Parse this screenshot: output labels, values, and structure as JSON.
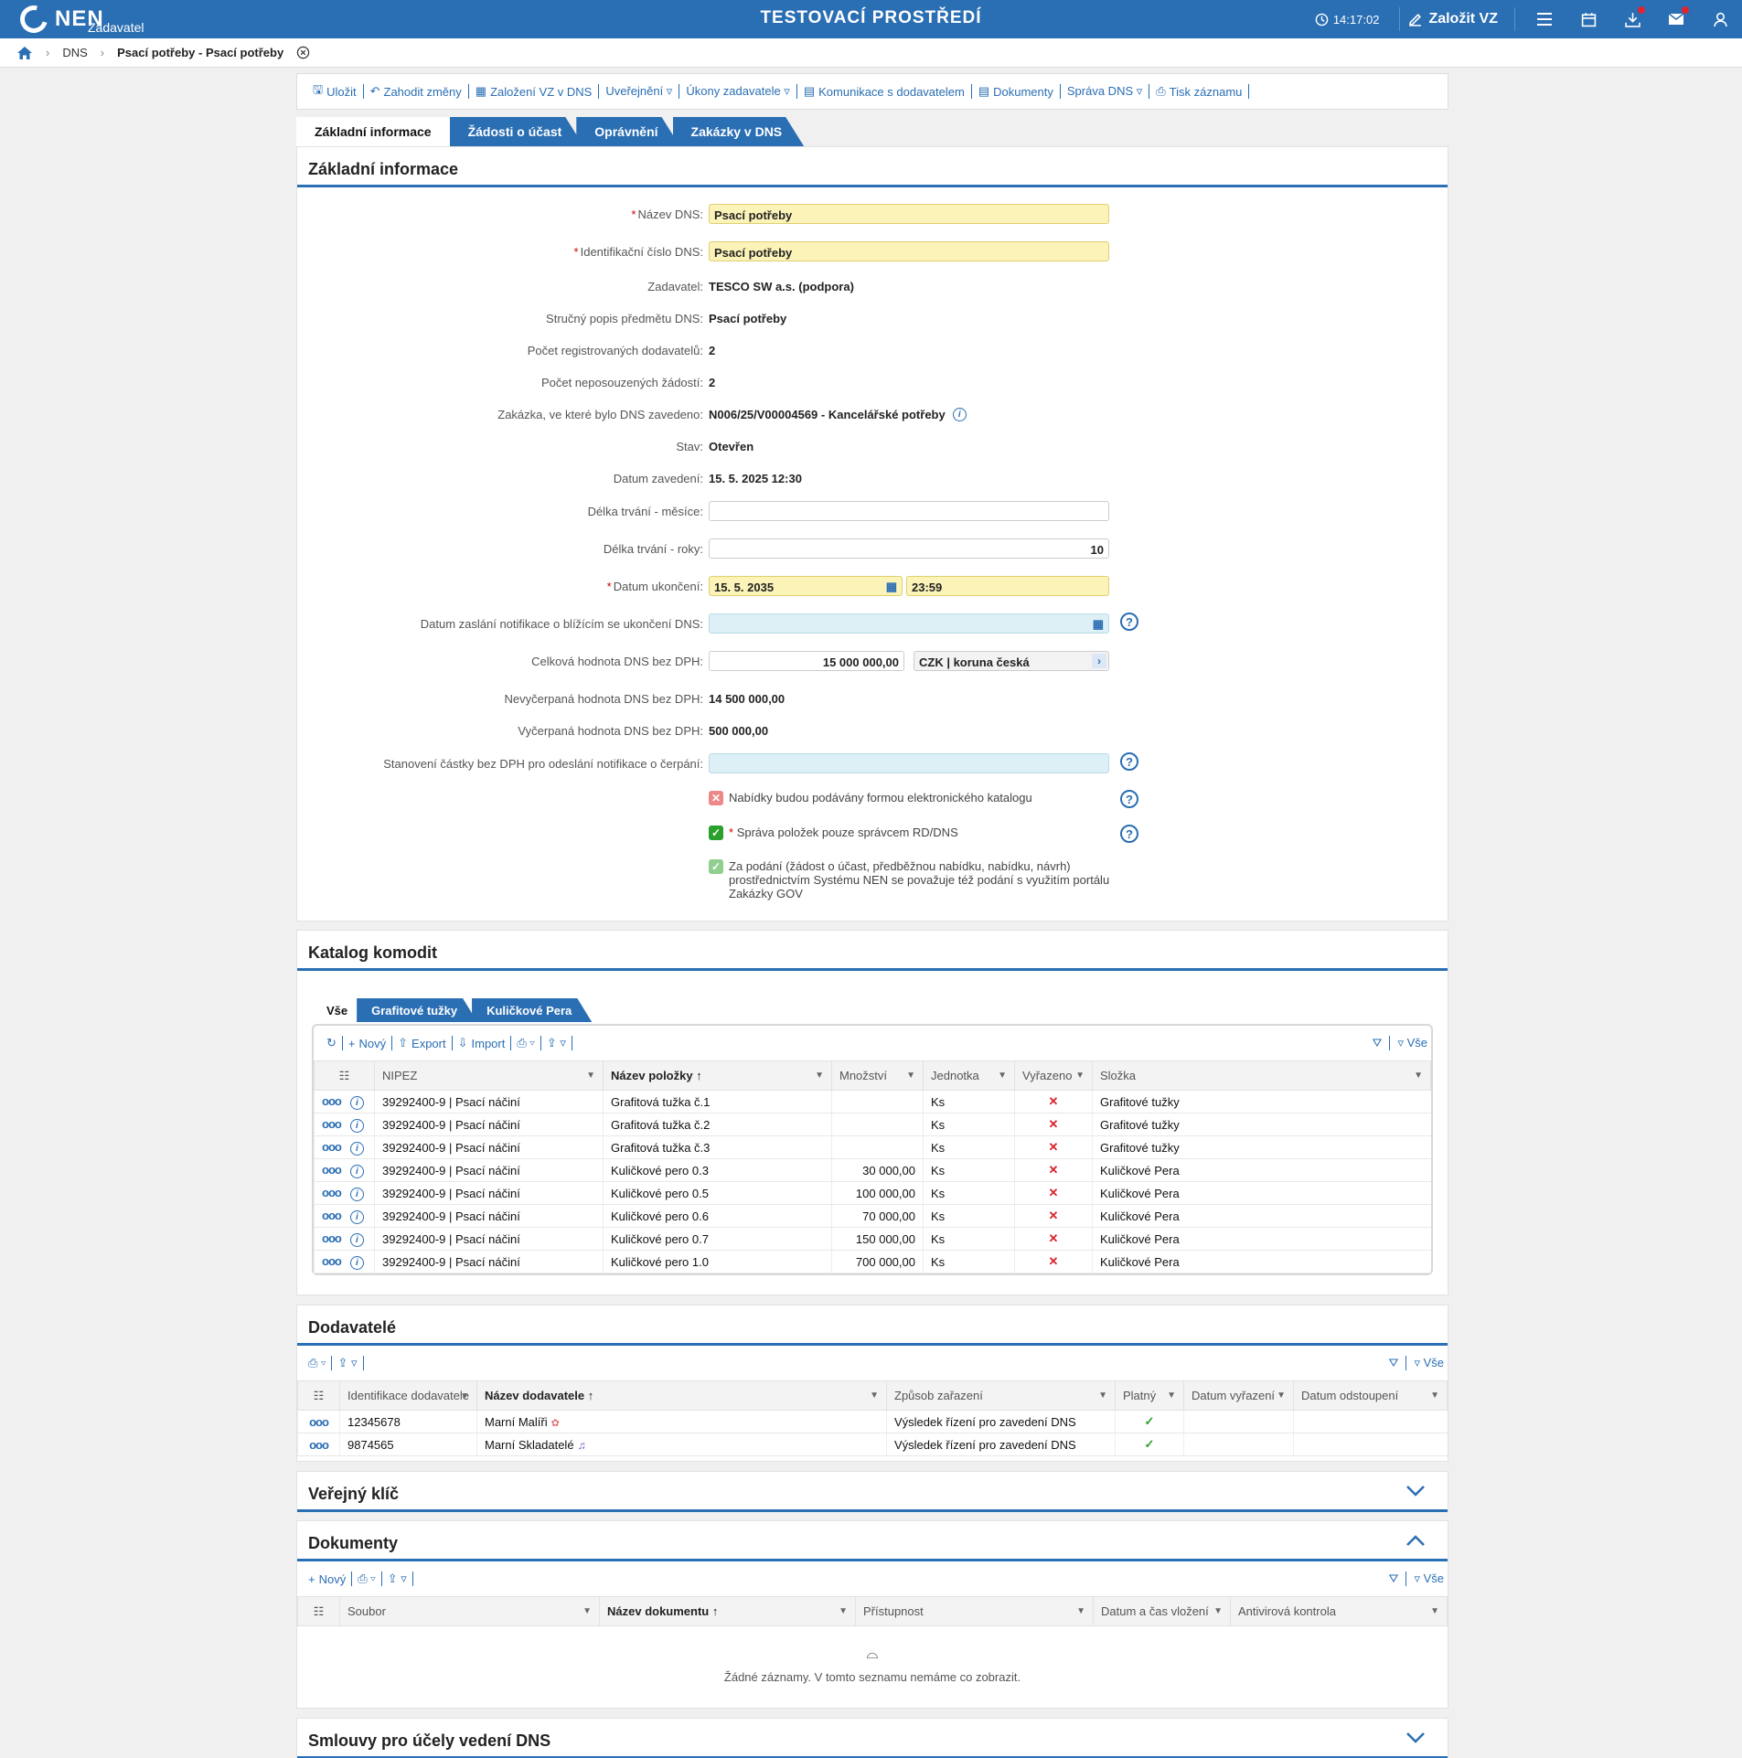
{
  "topbar": {
    "logo": "NEN",
    "role": "Zadavatel",
    "env": "TESTOVACÍ PROSTŘEDÍ",
    "time": "14:17:02",
    "create": "Založit VZ"
  },
  "breadcrumb": {
    "dns": "DNS",
    "current": "Psací potřeby - Psací potřeby"
  },
  "toolbar": [
    "Uložit",
    "Zahodit změny",
    "Založení VZ v DNS",
    "Uveřejnění ▿",
    "Úkony zadavatele ▿",
    "Komunikace s dodavatelem",
    "Dokumenty",
    "Správa DNS ▿",
    "Tisk záznamu"
  ],
  "tabs": [
    "Základní informace",
    "Žádosti o účast",
    "Oprávnění",
    "Zakázky v DNS"
  ],
  "basic": {
    "title": "Základní informace",
    "nazev_label": "Název DNS:",
    "nazev": "Psací potřeby",
    "id_label": "Identifikační číslo DNS:",
    "id": "Psací potřeby",
    "zad_label": "Zadavatel:",
    "zad": "TESCO SW a.s. (podpora)",
    "popis_label": "Stručný popis předmětu DNS:",
    "popis": "Psací potřeby",
    "poc_reg_label": "Počet registrovaných dodavatelů:",
    "poc_reg": "2",
    "poc_nep_label": "Počet neposouzených žádostí:",
    "poc_nep": "2",
    "zakazka_label": "Zakázka, ve které bylo DNS zavedeno:",
    "zakazka": "N006/25/V00004569 - Kancelářské potřeby",
    "stav_label": "Stav:",
    "stav": "Otevřen",
    "datum_zav_label": "Datum zavedení:",
    "datum_zav": "15. 5. 2025 12:30",
    "delka_m_label": "Délka trvání - měsíce:",
    "delka_m": "",
    "delka_r_label": "Délka trvání - roky:",
    "delka_r": "10",
    "datum_uk_label": "Datum ukončení:",
    "datum_uk": "15. 5. 2035",
    "cas_uk": "23:59",
    "notif_label": "Datum zaslání notifikace o blížícím se ukončení DNS:",
    "hodnota_label": "Celková hodnota DNS bez DPH:",
    "hodnota": "15 000 000,00",
    "mena": "CZK | koruna česká",
    "nevycerp_label": "Nevyčerpaná hodnota DNS bez DPH:",
    "nevycerp": "14 500 000,00",
    "vycerp_label": "Vyčerpaná hodnota DNS bez DPH:",
    "vycerp": "500 000,00",
    "stanoveni_label": "Stanovení částky bez DPH pro odeslání notifikace o čerpání:",
    "chk1": "Nabídky budou podávány formou elektronického katalogu",
    "chk2": "Správa položek pouze správcem RD/DNS",
    "chk3": "Za podání (žádost o účast, předběžnou nabídku, nabídku, návrh) prostřednictvím Systému NEN se považuje též podání s využitím portálu Zakázky GOV"
  },
  "catalog": {
    "title": "Katalog komodit",
    "subtabs": [
      "Vše",
      "Grafitové tužky",
      "Kuličkové Pera"
    ],
    "tools": [
      "Nový",
      "Export",
      "Import"
    ],
    "all": "Vše",
    "cols": [
      "NIPEZ",
      "Název položky",
      "Množství",
      "Jednotka",
      "Vyřazeno",
      "Složka"
    ],
    "rows": [
      [
        "39292400-9 | Psací náčiní",
        "Grafitová tužka č.1",
        "",
        "Ks",
        "✕",
        "Grafitové tužky"
      ],
      [
        "39292400-9 | Psací náčiní",
        "Grafitová tužka č.2",
        "",
        "Ks",
        "✕",
        "Grafitové tužky"
      ],
      [
        "39292400-9 | Psací náčiní",
        "Grafitová tužka č.3",
        "",
        "Ks",
        "✕",
        "Grafitové tužky"
      ],
      [
        "39292400-9 | Psací náčiní",
        "Kuličkové pero 0.3",
        "30 000,00",
        "Ks",
        "✕",
        "Kuličkové Pera"
      ],
      [
        "39292400-9 | Psací náčiní",
        "Kuličkové pero 0.5",
        "100 000,00",
        "Ks",
        "✕",
        "Kuličkové Pera"
      ],
      [
        "39292400-9 | Psací náčiní",
        "Kuličkové pero 0.6",
        "70 000,00",
        "Ks",
        "✕",
        "Kuličkové Pera"
      ],
      [
        "39292400-9 | Psací náčiní",
        "Kuličkové pero 0.7",
        "150 000,00",
        "Ks",
        "✕",
        "Kuličkové Pera"
      ],
      [
        "39292400-9 | Psací náčiní",
        "Kuličkové pero 1.0",
        "700 000,00",
        "Ks",
        "✕",
        "Kuličkové Pera"
      ]
    ]
  },
  "suppliers": {
    "title": "Dodavatelé",
    "all": "Vše",
    "cols": [
      "Identifikace dodavatele",
      "Název dodavatele",
      "Způsob zařazení",
      "Platný",
      "Datum vyřazení",
      "Datum odstoupení"
    ],
    "rows": [
      [
        "12345678",
        "Marní Malíři",
        "Výsledek řízení pro zavedení DNS",
        "✓",
        "",
        ""
      ],
      [
        "9874565",
        "Marní Skladatelé",
        "Výsledek řízení pro zavedení DNS",
        "✓",
        "",
        ""
      ]
    ]
  },
  "pubkey": {
    "title": "Veřejný klíč"
  },
  "docs": {
    "title": "Dokumenty",
    "new": "Nový",
    "all": "Vše",
    "cols": [
      "Soubor",
      "Název dokumentu",
      "Přístupnost",
      "Datum a čas vložení",
      "Antivirová kontrola"
    ],
    "empty": "Žádné záznamy. V tomto seznamu nemáme co zobrazit."
  },
  "contracts": {
    "title": "Smlouvy pro účely vedení DNS"
  }
}
